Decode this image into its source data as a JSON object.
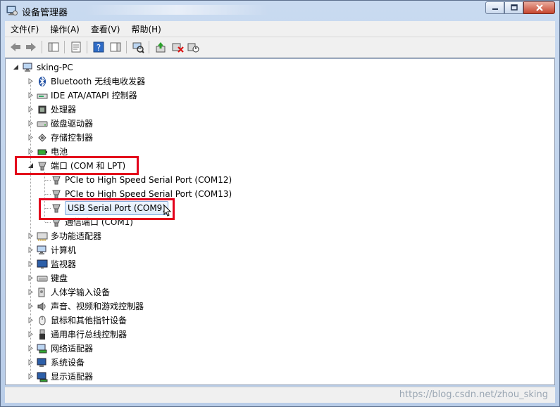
{
  "window": {
    "title": "设备管理器"
  },
  "menu": [
    "文件(F)",
    "操作(A)",
    "查看(V)",
    "帮助(H)"
  ],
  "tree": {
    "root": "sking-PC",
    "categories": [
      {
        "label": "Bluetooth 无线电收发器",
        "icon": "bluetooth-icon"
      },
      {
        "label": "IDE ATA/ATAPI 控制器",
        "icon": "ide-controller-icon"
      },
      {
        "label": "处理器",
        "icon": "processor-icon"
      },
      {
        "label": "磁盘驱动器",
        "icon": "disk-drive-icon"
      },
      {
        "label": "存储控制器",
        "icon": "storage-controller-icon"
      },
      {
        "label": "电池",
        "icon": "battery-icon"
      },
      {
        "label": "端口 (COM 和 LPT)",
        "icon": "port-icon"
      },
      {
        "label": "多功能适配器",
        "icon": "multifunction-adapter-icon"
      },
      {
        "label": "计算机",
        "icon": "computer-icon"
      },
      {
        "label": "监视器",
        "icon": "monitor-icon"
      },
      {
        "label": "键盘",
        "icon": "keyboard-icon"
      },
      {
        "label": "人体学输入设备",
        "icon": "hid-icon"
      },
      {
        "label": "声音、视频和游戏控制器",
        "icon": "sound-icon"
      },
      {
        "label": "鼠标和其他指针设备",
        "icon": "mouse-icon"
      },
      {
        "label": "通用串行总线控制器",
        "icon": "usb-controller-icon"
      },
      {
        "label": "网络适配器",
        "icon": "network-adapter-icon"
      },
      {
        "label": "系统设备",
        "icon": "system-device-icon"
      },
      {
        "label": "显示适配器",
        "icon": "display-adapter-icon"
      }
    ],
    "ports": [
      {
        "label": "PCIe to High Speed Serial Port (COM12)"
      },
      {
        "label": "PCIe to High Speed Serial Port (COM13)"
      },
      {
        "label": "USB Serial Port (COM9)",
        "selected": true
      },
      {
        "label": "通信端口 (COM1)"
      }
    ]
  },
  "status": {
    "watermark": "https://blog.csdn.net/zhou_sking"
  },
  "colors": {
    "highlight_box": "#e3001b",
    "selection": "#dcebfc"
  }
}
